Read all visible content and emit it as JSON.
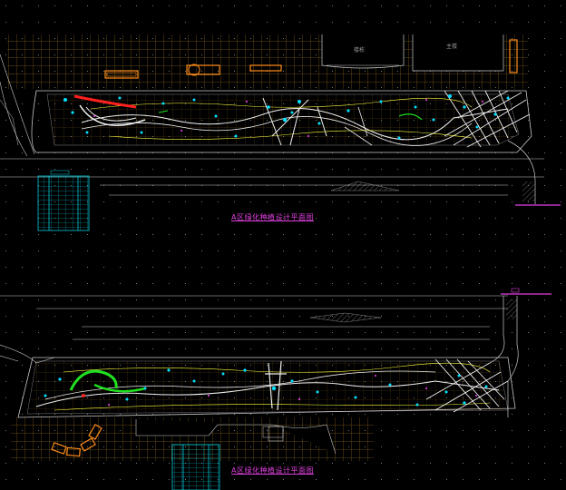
{
  "drawing": {
    "top_plan_title": "A区绿化种植设计平面图",
    "bottom_plan_title": "A区绿化种植设计平面图",
    "building_label_left": "楼栋",
    "building_label_right": "主楼"
  },
  "colors": {
    "background": "#000000",
    "grid_dots": "#7a7a7a",
    "paving": "#b8862a",
    "boundary": "#c8c8c8",
    "planting": "#f0f0f0",
    "shrub": "#ff2020",
    "lawn": "#20e020",
    "tree_symbol": "#00e0ff",
    "path_yellow": "#ffff40",
    "title_magenta": "#e040e0",
    "table_cyan": "#00c8d8",
    "bench_orange": "#ff8c1a"
  }
}
